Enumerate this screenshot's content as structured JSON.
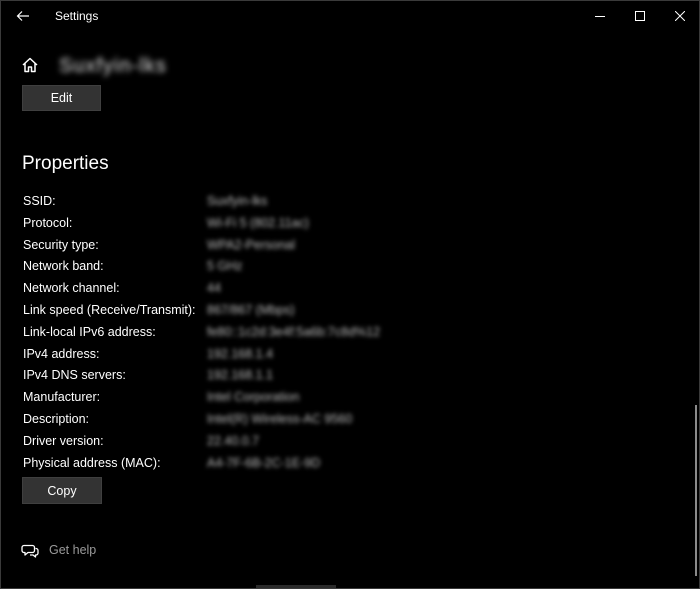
{
  "window": {
    "title": "Settings"
  },
  "header": {
    "network_name": "Suxfyin-lks"
  },
  "buttons": {
    "edit_label": "Edit",
    "copy_label": "Copy"
  },
  "properties": {
    "title": "Properties",
    "rows": [
      {
        "label": "SSID:",
        "value": "Suxfyin-lks"
      },
      {
        "label": "Protocol:",
        "value": "Wi-Fi 5 (802.11ac)"
      },
      {
        "label": "Security type:",
        "value": "WPA2-Personal"
      },
      {
        "label": "Network band:",
        "value": "5 GHz"
      },
      {
        "label": "Network channel:",
        "value": "44"
      },
      {
        "label": "Link speed (Receive/Transmit):",
        "value": "867/867 (Mbps)"
      },
      {
        "label": "Link-local IPv6 address:",
        "value": "fe80::1c2d:3e4f:5a6b:7c8d%12"
      },
      {
        "label": "IPv4 address:",
        "value": "192.168.1.4"
      },
      {
        "label": "IPv4 DNS servers:",
        "value": "192.168.1.1"
      },
      {
        "label": "Manufacturer:",
        "value": "Intel Corporation"
      },
      {
        "label": "Description:",
        "value": "Intel(R) Wireless-AC 9560"
      },
      {
        "label": "Driver version:",
        "value": "22.40.0.7"
      },
      {
        "label": "Physical address (MAC):",
        "value": "A4-7F-6B-2C-1E-9D"
      }
    ]
  },
  "help": {
    "label": "Get help"
  },
  "icons": {
    "back": "back-arrow-icon",
    "home": "home-icon",
    "minimize": "minimize-icon",
    "maximize": "maximize-icon",
    "close": "close-icon",
    "help": "help-chat-icon"
  }
}
